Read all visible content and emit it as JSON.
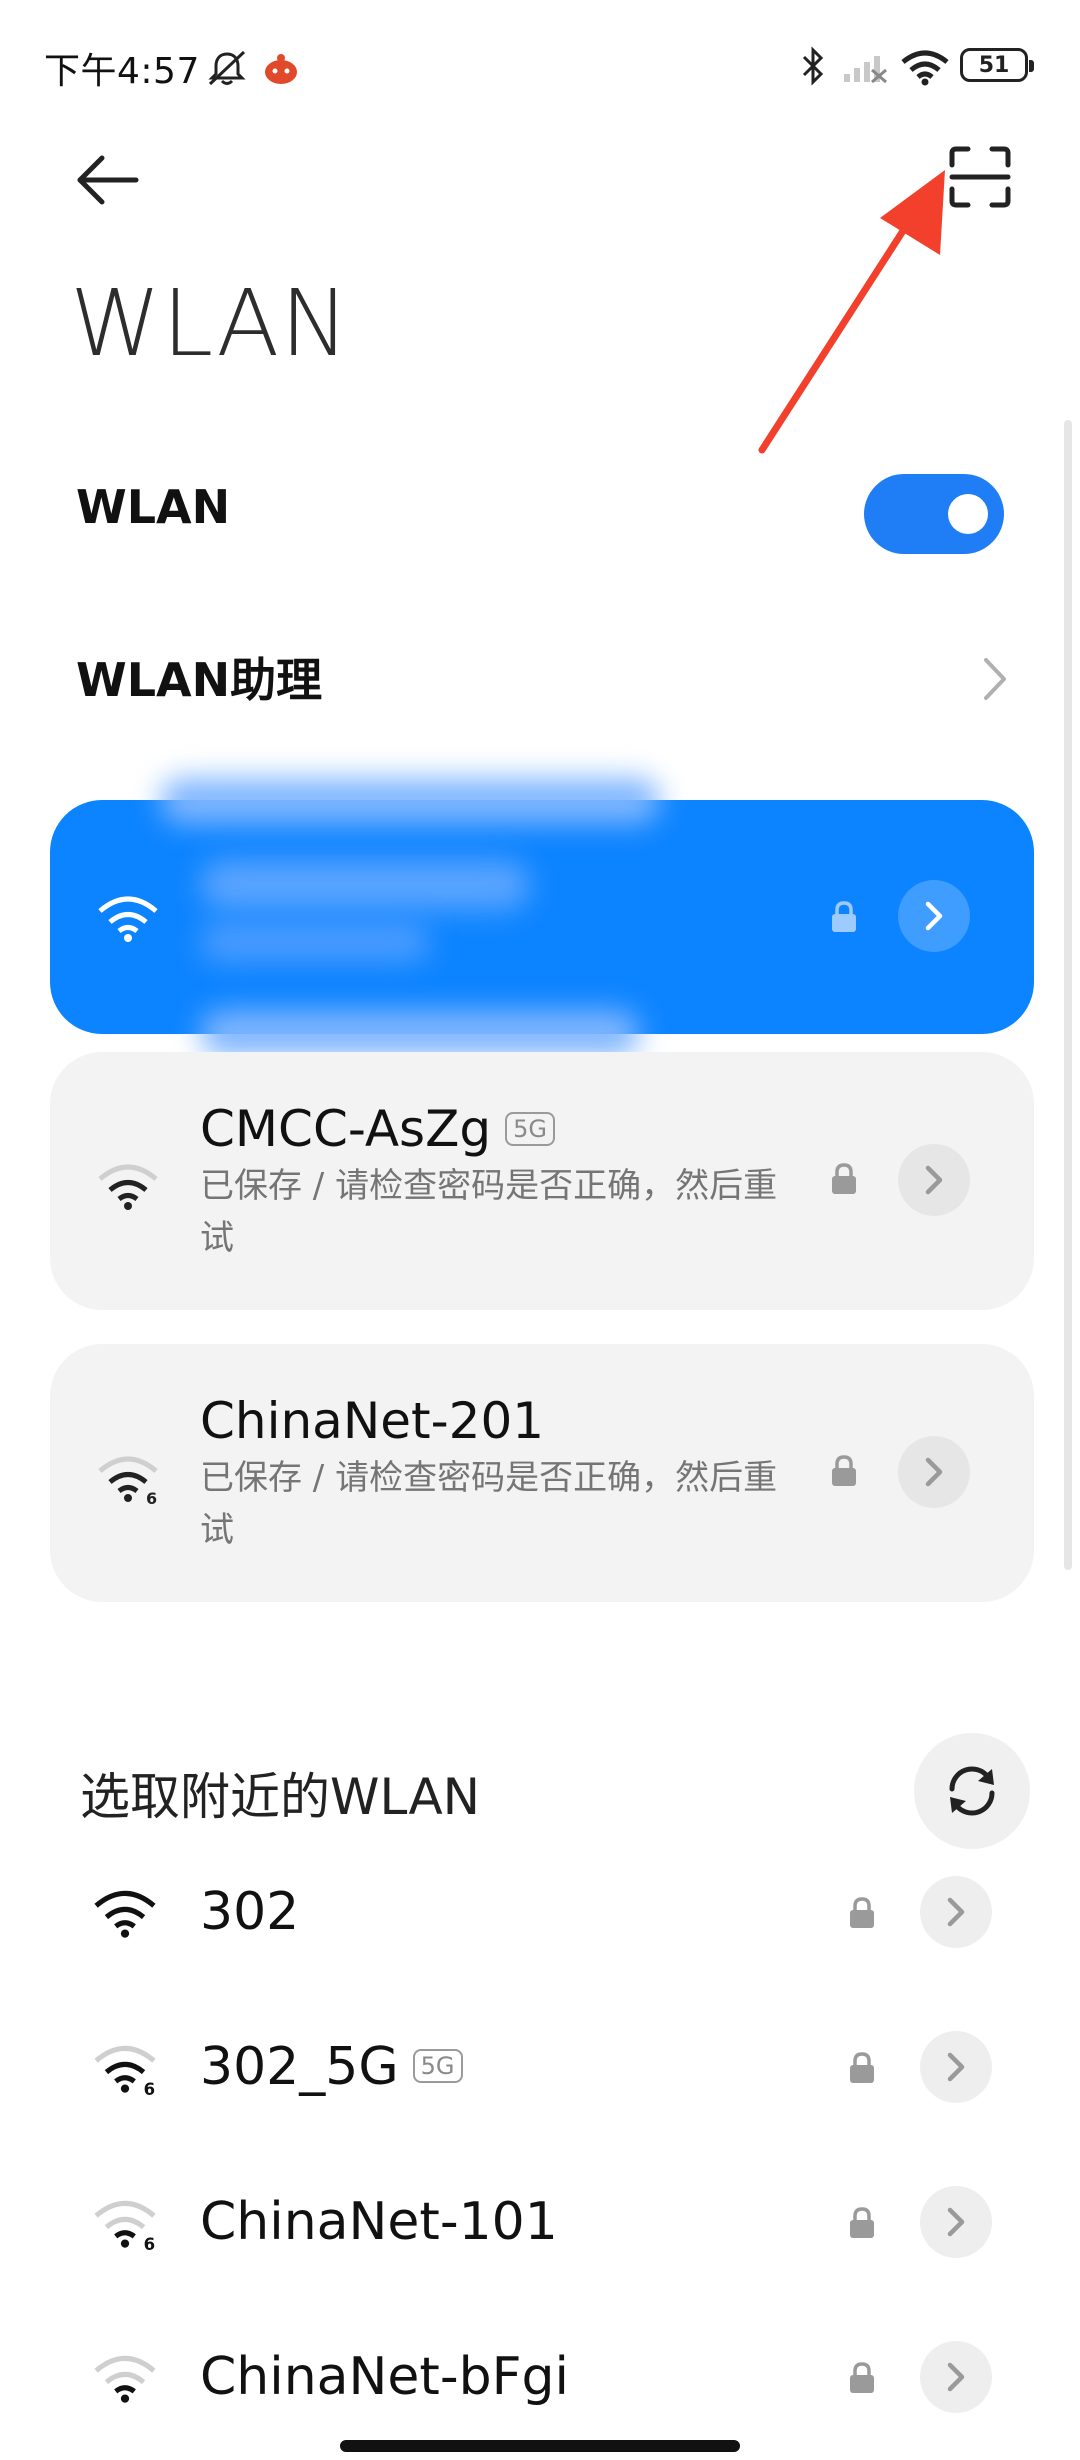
{
  "status_bar": {
    "time": "下午4:57",
    "battery": "51",
    "icons": [
      "mute-bell-icon",
      "app-notification-icon",
      "bluetooth-icon",
      "signal-icon",
      "wifi-icon",
      "battery-icon"
    ]
  },
  "header": {
    "title": "WLAN",
    "back_icon": "back-arrow-icon",
    "scan_icon": "scan-qr-icon"
  },
  "settings": {
    "wlan_toggle_label": "WLAN",
    "wlan_toggle_on": true,
    "assistant_label": "WLAN助理"
  },
  "saved_networks": [
    {
      "name": "CMCC-AsZg",
      "badge": "5G",
      "status": "已保存 / 请检查密码是否正确，然后重试"
    },
    {
      "name": "ChinaNet-201",
      "badge": "",
      "status": "已保存 / 请检查密码是否正确，然后重试"
    }
  ],
  "nearby": {
    "section_title": "选取附近的WLAN",
    "networks": [
      {
        "name": "302",
        "badge": ""
      },
      {
        "name": "302_5G",
        "badge": "5G"
      },
      {
        "name": "ChinaNet-101",
        "badge": ""
      },
      {
        "name": "ChinaNet-bFgi",
        "badge": ""
      }
    ]
  },
  "colors": {
    "accent": "#0d84ff",
    "toggle": "#1f7ef5",
    "annotation": "#f2402c"
  }
}
